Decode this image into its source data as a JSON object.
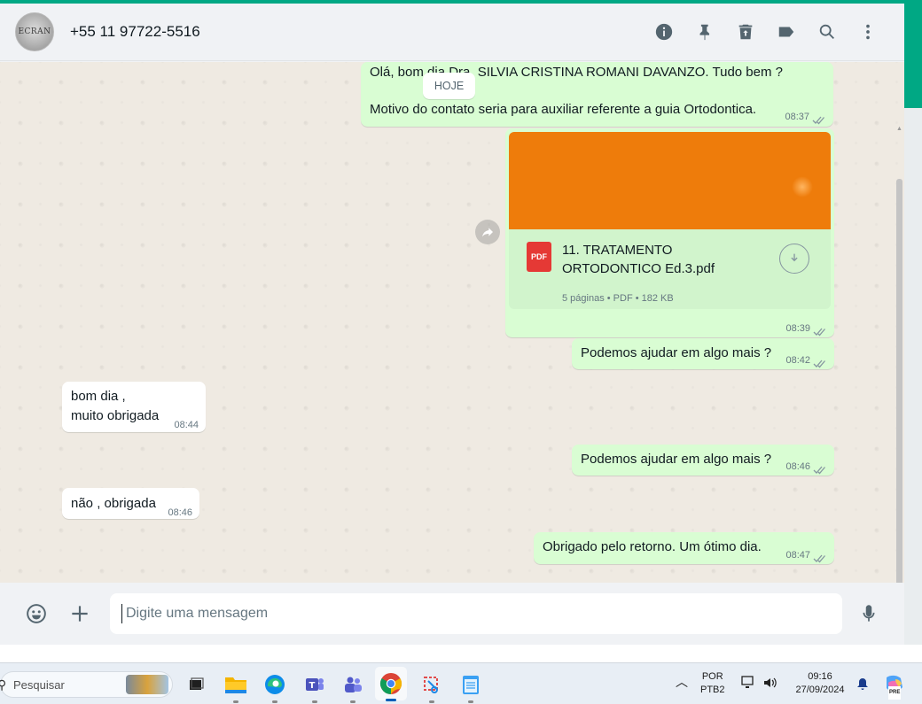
{
  "window": {
    "accent_color": "#00a884",
    "outgoing_bubble_color": "#d9fdd3",
    "incoming_bubble_color": "#ffffff"
  },
  "header": {
    "avatar_text": "ECRAN",
    "contact_name": "+55 11 97722-5516",
    "icons": [
      "info-icon",
      "pin-icon",
      "delete-icon",
      "label-icon",
      "search-icon",
      "menu-icon"
    ]
  },
  "chat": {
    "date_divider": "HOJE",
    "messages": [
      {
        "direction": "out",
        "text_line1": "Olá, bom dia Dra. SILVIA CRISTINA ROMANI DAVANZO. Tudo bem ?",
        "text_line2": "Motivo do contato seria para auxiliar referente a guia Ortodontica.",
        "time": "08:37",
        "status": "read"
      },
      {
        "direction": "out",
        "type": "document",
        "file_type": "PDF",
        "file_name": "11. TRATAMENTO ORTODONTICO Ed.3.pdf",
        "meta": "5 páginas • PDF • 182 KB",
        "time": "08:39",
        "status": "read"
      },
      {
        "direction": "out",
        "text": "Podemos ajudar em algo mais ?",
        "time": "08:42",
        "status": "read"
      },
      {
        "direction": "in",
        "text_line1": "bom dia ,",
        "text_line2": "muito obrigada",
        "time": "08:44"
      },
      {
        "direction": "out",
        "text": "Podemos ajudar em algo mais ?",
        "time": "08:46",
        "status": "read"
      },
      {
        "direction": "in",
        "text": "não , obrigada",
        "time": "08:46"
      },
      {
        "direction": "out",
        "text": "Obrigado pelo retorno. Um ótimo dia.",
        "time": "08:47",
        "status": "read"
      }
    ]
  },
  "composer": {
    "placeholder": "Digite uma mensagem",
    "icons": [
      "emoji-icon",
      "plus-icon",
      "microphone-icon"
    ]
  },
  "taskbar": {
    "search_label": "Pesquisar",
    "apps": [
      "task-view",
      "file-explorer",
      "edge",
      "teams-classic",
      "teams",
      "chrome",
      "snipping-tool",
      "notepad"
    ],
    "active_app": "chrome",
    "language_line1": "POR",
    "language_line2": "PTB2",
    "clock_time": "09:16",
    "clock_date": "27/09/2024",
    "copilot_badge": "PRE"
  }
}
